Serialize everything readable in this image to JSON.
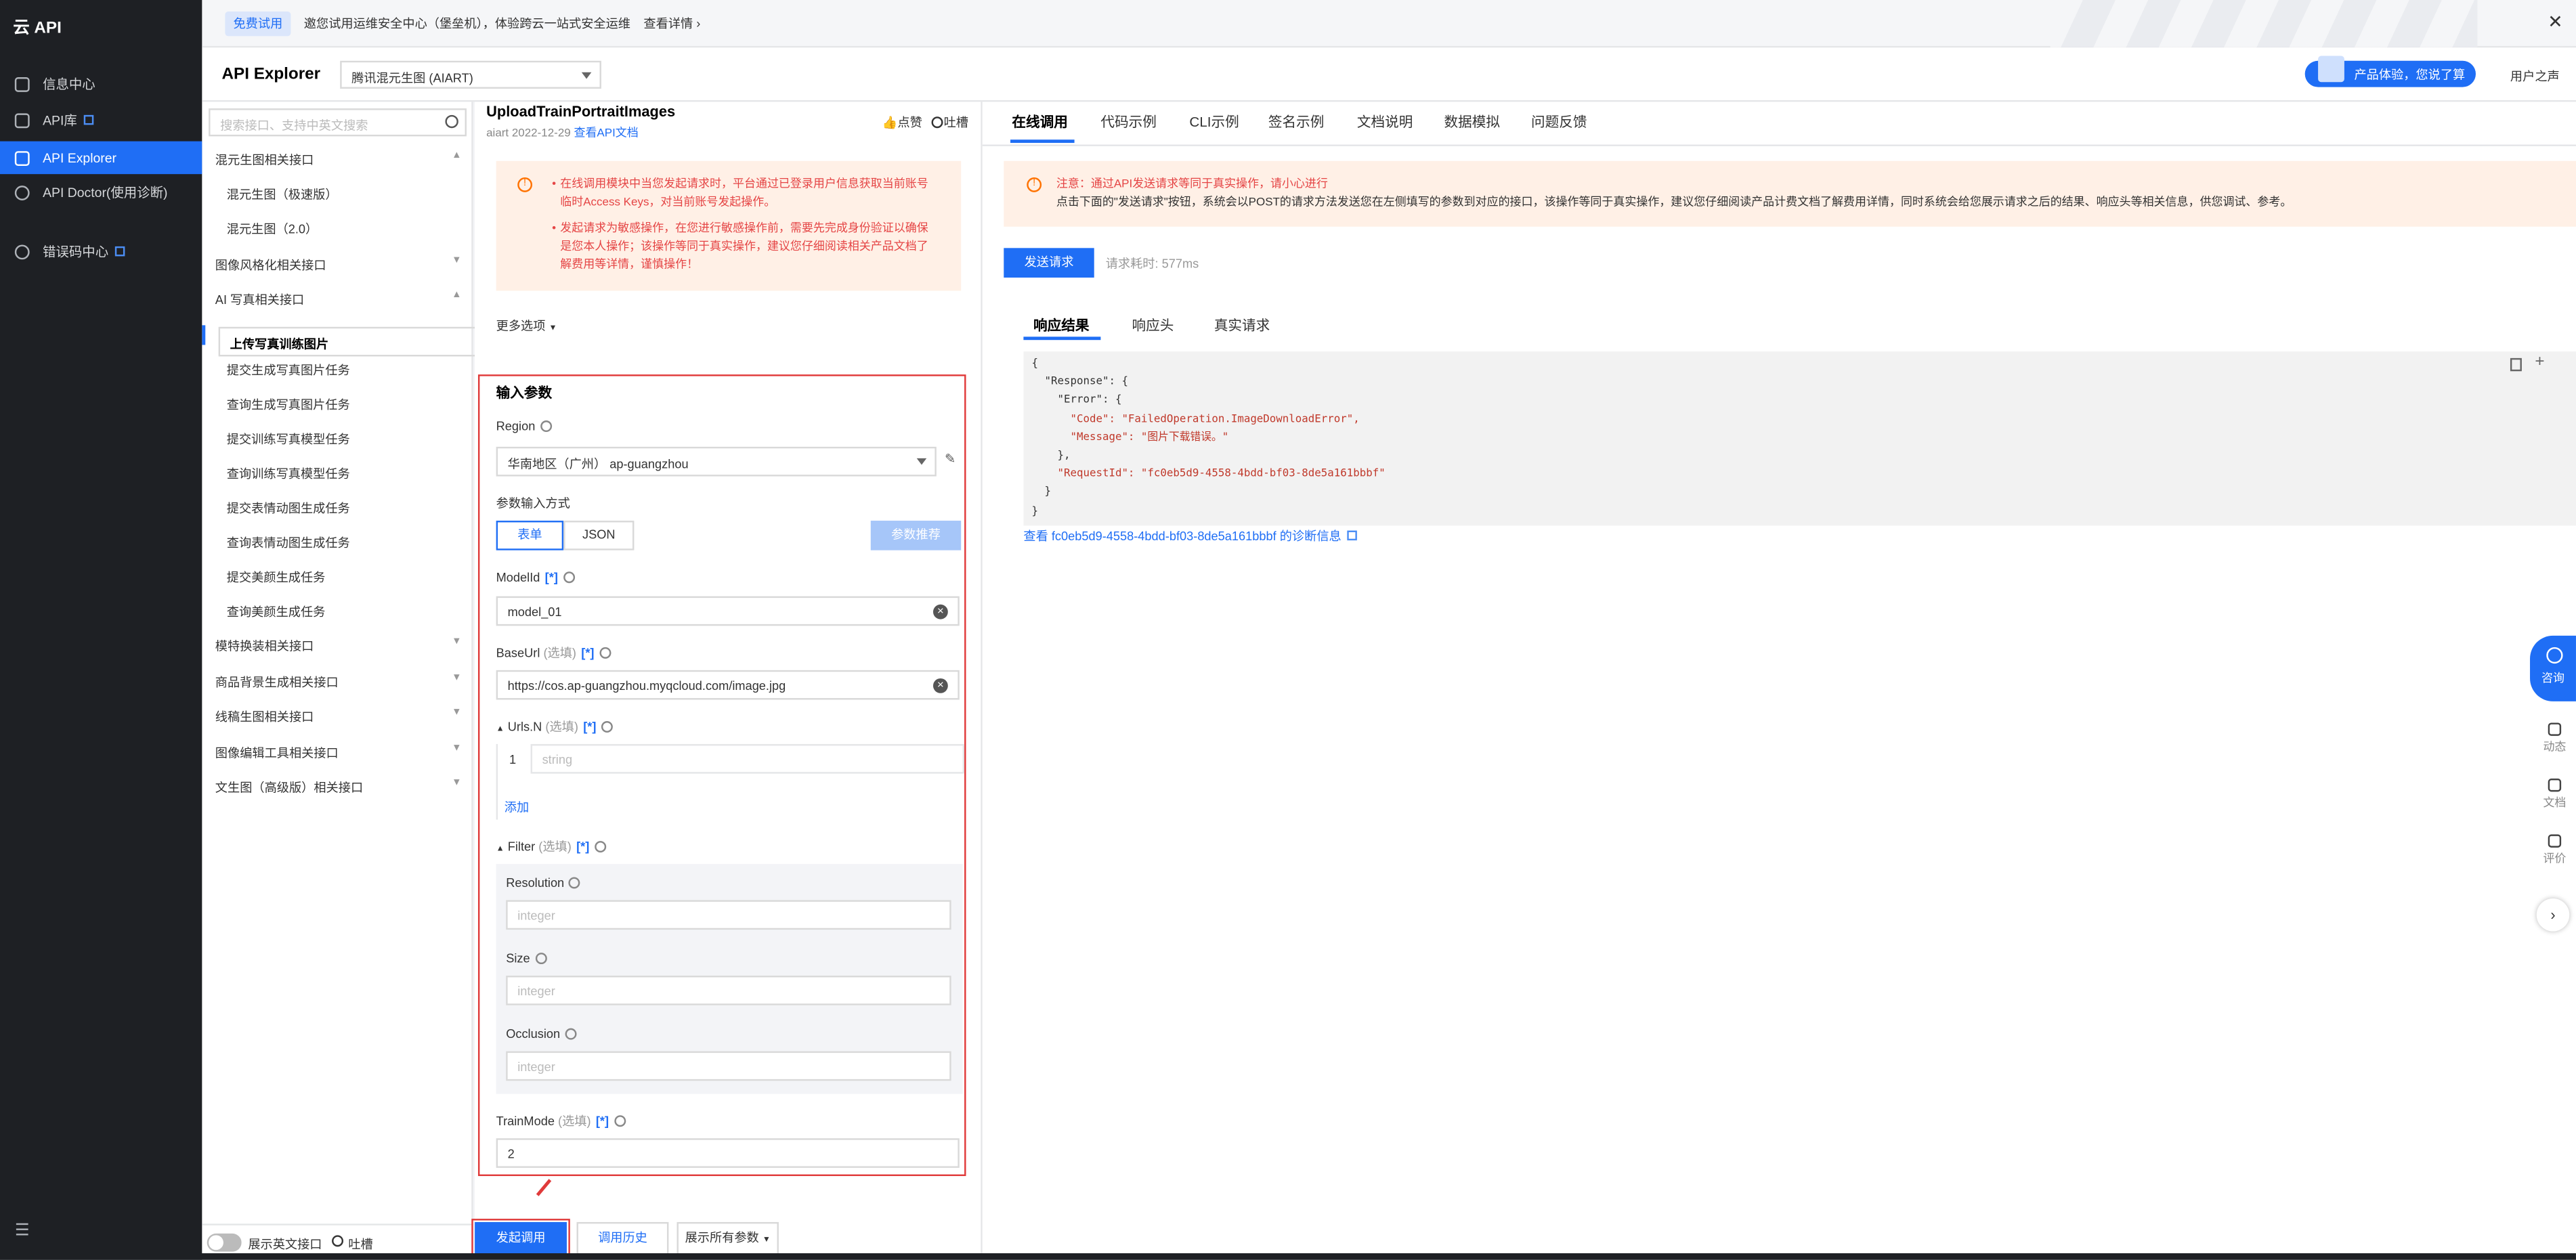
{
  "nav": {
    "logo": "云 API",
    "items": [
      {
        "label": "信息中心",
        "icon": "grid-icon"
      },
      {
        "label": "API库",
        "icon": "library-icon"
      },
      {
        "label": "API Explorer",
        "icon": "monitor-icon"
      },
      {
        "label": "API Doctor(使用诊断)",
        "icon": "doctor-icon"
      },
      {
        "label": "错误码中心",
        "icon": "info-icon"
      }
    ],
    "menu_icon": "menu-icon"
  },
  "banner": {
    "badge": "免费试用",
    "text": "邀您试用运维安全中心（堡垒机），体验跨云一站式安全运维",
    "link": "查看详情 ›",
    "close": "✕"
  },
  "header": {
    "title": "API Explorer",
    "product": "腾讯混元生图 (AIART)",
    "promo": "产品体验，您说了算",
    "voice": "用户之声"
  },
  "apilist": {
    "search_placeholder": "搜索接口、支持中英文搜索",
    "groups": [
      {
        "label": "混元生图相关接口",
        "arrow": "▲"
      },
      {
        "label": "混元生图（极速版）"
      },
      {
        "label": "混元生图（2.0）"
      },
      {
        "label": "图像风格化相关接口",
        "arrow": "▼"
      },
      {
        "label": "AI 写真相关接口",
        "arrow": "▲"
      },
      {
        "label": "上传写真训练图片"
      },
      {
        "label": "提交生成写真图片任务"
      },
      {
        "label": "查询生成写真图片任务"
      },
      {
        "label": "提交训练写真模型任务"
      },
      {
        "label": "查询训练写真模型任务"
      },
      {
        "label": "提交表情动图生成任务"
      },
      {
        "label": "查询表情动图生成任务"
      },
      {
        "label": "提交美颜生成任务"
      },
      {
        "label": "查询美颜生成任务"
      },
      {
        "label": "模特换装相关接口",
        "arrow": "▼"
      },
      {
        "label": "商品背景生成相关接口",
        "arrow": "▼"
      },
      {
        "label": "线稿生图相关接口",
        "arrow": "▼"
      },
      {
        "label": "图像编辑工具相关接口",
        "arrow": "▼"
      },
      {
        "label": "文生图（高级版）相关接口",
        "arrow": "▼"
      }
    ],
    "toggle_label": "展示英文接口",
    "feedback": "吐槽"
  },
  "mid": {
    "api_name": "UploadTrainPortraitImages",
    "api_date": "aiart 2022-12-29",
    "doc_link": "查看API文档",
    "like": "点赞",
    "complain": "吐槽",
    "warn1": "在线调用模块中当您发起请求时，平台通过已登录用户信息获取当前账号临时Access Keys，对当前账号发起操作。",
    "warn2": "发起请求为敏感操作，在您进行敏感操作前，需要先完成身份验证以确保是您本人操作；该操作等同于真实操作，建议您仔细阅读相关产品文档了解费用等详情，谨慎操作！",
    "more": "更多选项",
    "params_title": "输入参数",
    "region_label": "Region",
    "region_value": "华南地区（广州） ap-guangzhou",
    "input_mode": "参数输入方式",
    "mode_form": "表单",
    "mode_json": "JSON",
    "recommend": "参数推荐",
    "modelid_label": "ModelId",
    "tag": "[*]",
    "modelid_value": "model_01",
    "baseurl_label": "BaseUrl",
    "optional": "(选填)",
    "baseurl_value": "https://cos.ap-guangzhou.myqcloud.com/image.jpg",
    "urls_label": "Urls.N",
    "urls_index": "1",
    "urls_placeholder": "string",
    "add": "添加",
    "filter_label": "Filter",
    "resolution_label": "Resolution",
    "size_label": "Size",
    "occlusion_label": "Occlusion",
    "int_placeholder": "integer",
    "trainmode_label": "TrainMode",
    "trainmode_value": "2",
    "btn_invoke": "发起调用",
    "btn_history": "调用历史",
    "btn_show_all": "展示所有参数"
  },
  "right": {
    "tabs": [
      "在线调用",
      "代码示例",
      "CLI示例",
      "签名示例",
      "文档说明",
      "数据模拟",
      "问题反馈"
    ],
    "notice1": "注意：通过API发送请求等同于真实操作，请小心进行",
    "notice2": "点击下面的\"发送请求\"按钮，系统会以POST的请求方法发送您在左侧填写的参数到对应的接口，该操作等同于真实操作，建议您仔细阅读产品计费文档了解费用详情，同时系统会给您展示请求之后的结果、响应头等相关信息，供您调试、参考。",
    "send": "发送请求",
    "elapsed": "请求耗时: 577ms",
    "result_tabs": [
      "响应结果",
      "响应头",
      "真实请求"
    ],
    "code_lines": [
      "{",
      "  \"Response\": {",
      "    \"Error\": {",
      "      \"Code\": \"FailedOperation.ImageDownloadError\",",
      "      \"Message\": \"图片下载错误。\"",
      "    },",
      "    \"RequestId\": \"fc0eb5d9-4558-4bdd-bf03-8de5a161bbbf\"",
      "  }",
      "}"
    ],
    "diag_link": "查看 fc0eb5d9-4558-4bdd-bf03-8de5a161bbbf 的诊断信息"
  },
  "dock": {
    "consult": "咨询",
    "items": [
      "动态",
      "文档",
      "评价"
    ],
    "arrow": "›"
  }
}
